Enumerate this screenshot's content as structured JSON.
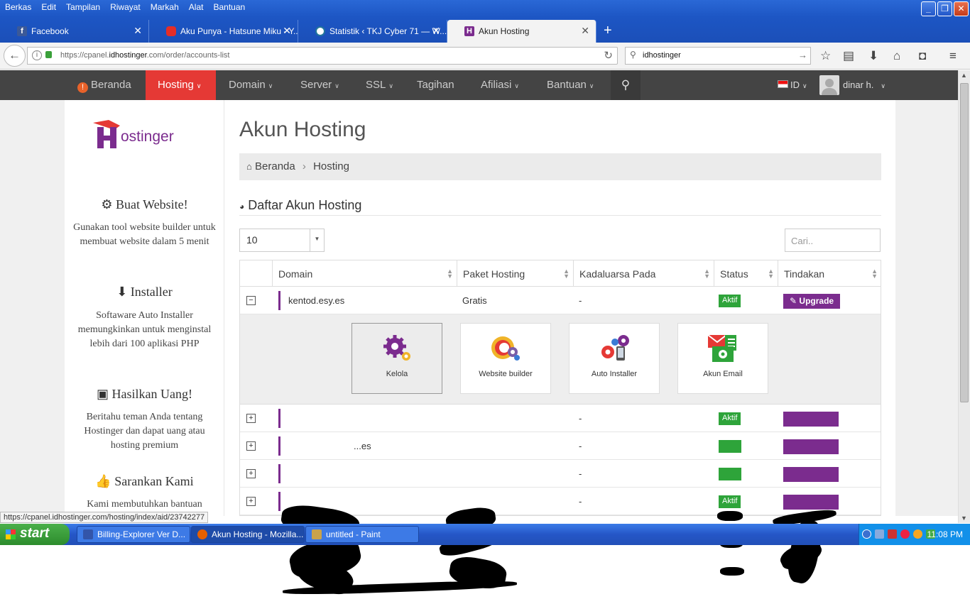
{
  "browser": {
    "menu": [
      "Berkas",
      "Edit",
      "Tampilan",
      "Riwayat",
      "Markah",
      "Alat",
      "Bantuan"
    ],
    "tabs": [
      {
        "label": "Facebook",
        "icon": "facebook-icon"
      },
      {
        "label": "Aku Punya - Hatsune Miku - Y...",
        "icon": "youtube-icon"
      },
      {
        "label": "Statistik ‹ TKJ Cyber 71 — W...",
        "icon": "wordpress-icon"
      },
      {
        "label": "Akun Hosting",
        "icon": "hostinger-icon"
      }
    ],
    "url_prefix": "https://cpanel.",
    "url_domain": "idhostinger",
    "url_suffix": ".com/order/accounts-list",
    "search_value": "idhostinger",
    "status_url": "https://cpanel.idhostinger.com/hosting/index/aid/23742277"
  },
  "site_nav": {
    "items": [
      "Beranda",
      "Hosting",
      "Domain",
      "Server",
      "SSL",
      "Tagihan",
      "Afiliasi",
      "Bantuan"
    ],
    "lang": "ID",
    "user": "dinar h."
  },
  "sidebar": {
    "sections": [
      {
        "title": "Buat Website!",
        "text": "Gunakan tool website builder untuk membuat website dalam 5 menit"
      },
      {
        "title": "Installer",
        "text": "Softaware Auto Installer memungkinkan untuk menginstal lebih dari 100 aplikasi PHP"
      },
      {
        "title": "Hasilkan Uang!",
        "text": "Beritahu teman Anda tentang Hostinger dan dapat uang atau hosting premium"
      },
      {
        "title": "Sarankan Kami",
        "text": "Kami membutuhkan bantuan"
      }
    ]
  },
  "main": {
    "title": "Akun Hosting",
    "breadcrumb": [
      "Beranda",
      "Hosting"
    ],
    "section_title": "Daftar Akun Hosting",
    "page_length": "10",
    "search_placeholder": "Cari..",
    "columns": [
      "Domain",
      "Paket Hosting",
      "Kadaluarsa Pada",
      "Status",
      "Tindakan"
    ],
    "rows": [
      {
        "domain": "kentod.esy.es",
        "plan": "Gratis",
        "expiry": "-",
        "status": "Aktif",
        "action": "Upgrade",
        "expanded": true
      },
      {
        "domain": "",
        "plan": "",
        "expiry": "-",
        "status": "Aktif",
        "action": ""
      },
      {
        "domain": "...es",
        "plan": "",
        "expiry": "-",
        "status": "",
        "action": ""
      },
      {
        "domain": "",
        "plan": "",
        "expiry": "-",
        "status": "",
        "action": ""
      },
      {
        "domain": "",
        "plan": "",
        "expiry": "-",
        "status": "Aktif",
        "action": ""
      }
    ],
    "tiles": [
      "Kelola",
      "Website builder",
      "Auto Installer",
      "Akun Email"
    ]
  },
  "taskbar": {
    "start": "start",
    "tasks": [
      "Billing-Explorer Ver D...",
      "Akun Hosting - Mozilla...",
      "untitled - Paint"
    ],
    "clock": "11:08 PM"
  },
  "colors": {
    "accent": "#e53935",
    "brand": "#7b2c8e",
    "status_active": "#2ea43a",
    "nav_bg": "#444444"
  }
}
